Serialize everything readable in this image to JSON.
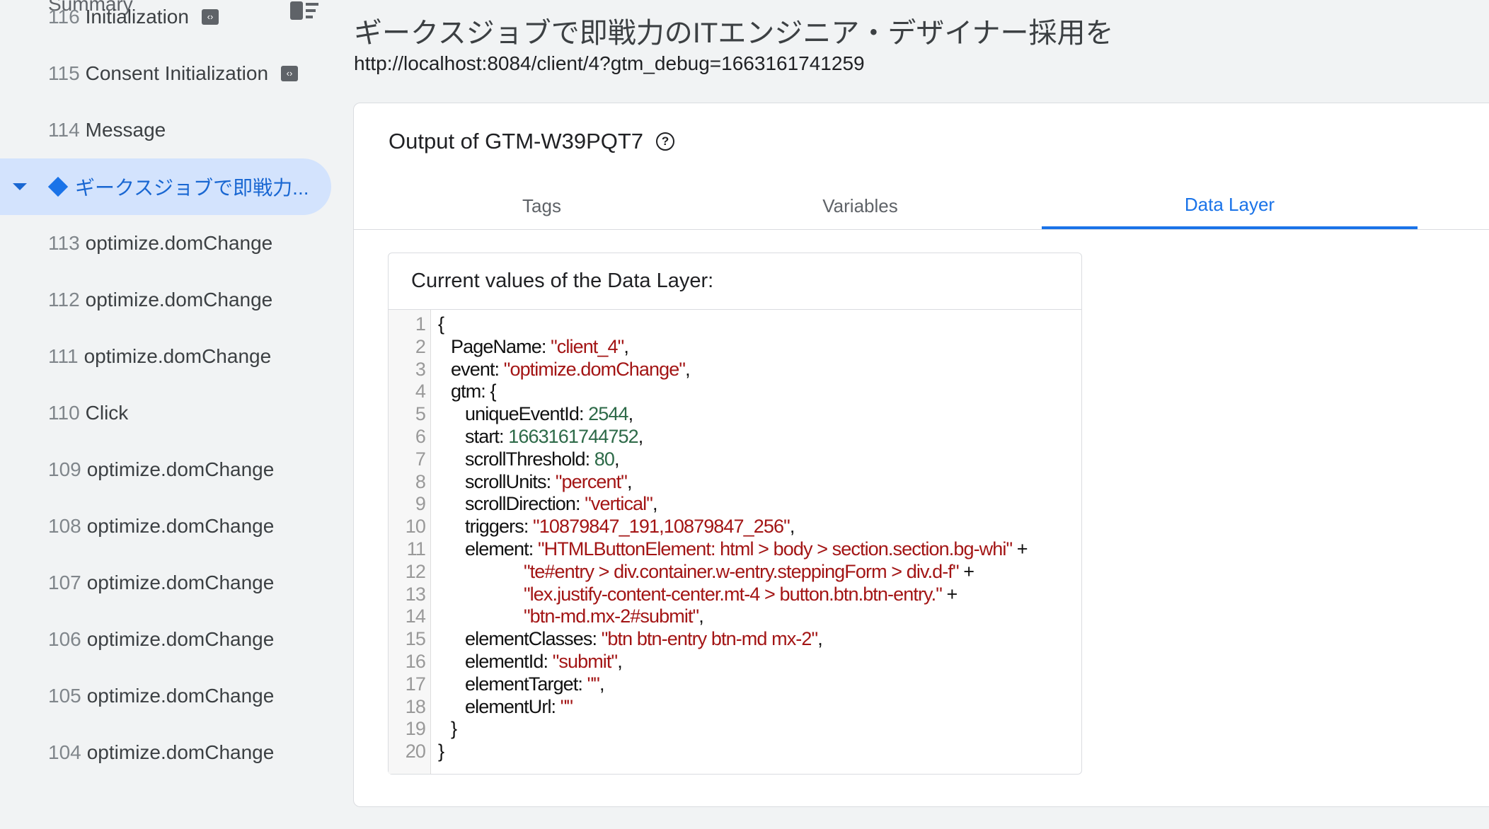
{
  "sidebar": {
    "summary": "Summary",
    "icon": "summary-layout-icon",
    "items": [
      {
        "num": "116",
        "label": "Initialization",
        "badge": true
      },
      {
        "num": "115",
        "label": "Consent Initialization",
        "badge": true
      },
      {
        "num": "114",
        "label": "Message"
      },
      {
        "num": "",
        "label": "ギークスジョブで即戦力...",
        "selected": true
      },
      {
        "num": "113",
        "label": "optimize.domChange"
      },
      {
        "num": "112",
        "label": "optimize.domChange"
      },
      {
        "num": "111",
        "label": "optimize.domChange"
      },
      {
        "num": "110",
        "label": "Click"
      },
      {
        "num": "109",
        "label": "optimize.domChange"
      },
      {
        "num": "108",
        "label": "optimize.domChange"
      },
      {
        "num": "107",
        "label": "optimize.domChange"
      },
      {
        "num": "106",
        "label": "optimize.domChange"
      },
      {
        "num": "105",
        "label": "optimize.domChange"
      },
      {
        "num": "104",
        "label": "optimize.domChange"
      }
    ]
  },
  "header": {
    "title": "ギークスジョブで即戦力のITエンジニア・デザイナー採用を",
    "url": "http://localhost:8084/client/4?gtm_debug=1663161741259"
  },
  "card": {
    "title": "Output of GTM-W39PQT7",
    "tabs": [
      {
        "label": "Tags"
      },
      {
        "label": "Variables"
      },
      {
        "label": "Data Layer",
        "active": true
      }
    ],
    "data_layer": {
      "heading": "Current values of the Data Layer:",
      "lines": [
        [
          {
            "t": "{"
          }
        ],
        [
          {
            "t": "PageName: "
          },
          {
            "t": "\"client_4\"",
            "c": "s"
          },
          {
            "t": ","
          }
        ],
        [
          {
            "t": "event: "
          },
          {
            "t": "\"optimize.domChange\"",
            "c": "s"
          },
          {
            "t": ","
          }
        ],
        [
          {
            "t": "gtm: {"
          }
        ],
        [
          {
            "t": "uniqueEventId: "
          },
          {
            "t": "2544",
            "c": "n"
          },
          {
            "t": ","
          }
        ],
        [
          {
            "t": "start: "
          },
          {
            "t": "1663161744752",
            "c": "n"
          },
          {
            "t": ","
          }
        ],
        [
          {
            "t": "scrollThreshold: "
          },
          {
            "t": "80",
            "c": "n"
          },
          {
            "t": ","
          }
        ],
        [
          {
            "t": "scrollUnits: "
          },
          {
            "t": "\"percent\"",
            "c": "s"
          },
          {
            "t": ","
          }
        ],
        [
          {
            "t": "scrollDirection: "
          },
          {
            "t": "\"vertical\"",
            "c": "s"
          },
          {
            "t": ","
          }
        ],
        [
          {
            "t": "triggers: "
          },
          {
            "t": "\"10879847_191,10879847_256\"",
            "c": "s"
          },
          {
            "t": ","
          }
        ],
        [
          {
            "t": "element: "
          },
          {
            "t": "\"HTMLButtonElement: html > body > section.section.bg-whi\"",
            "c": "s"
          },
          {
            "t": " +"
          }
        ],
        [
          {
            "t": "\"te#entry > div.container.w-entry.steppingForm > div.d-f\"",
            "c": "s"
          },
          {
            "t": " +"
          }
        ],
        [
          {
            "t": "\"lex.justify-content-center.mt-4 > button.btn.btn-entry.\"",
            "c": "s"
          },
          {
            "t": " +"
          }
        ],
        [
          {
            "t": "\"btn-md.mx-2#submit\"",
            "c": "s"
          },
          {
            "t": ","
          }
        ],
        [
          {
            "t": "elementClasses: "
          },
          {
            "t": "\"btn btn-entry btn-md mx-2\"",
            "c": "s"
          },
          {
            "t": ","
          }
        ],
        [
          {
            "t": "elementId: "
          },
          {
            "t": "\"submit\"",
            "c": "s"
          },
          {
            "t": ","
          }
        ],
        [
          {
            "t": "elementTarget: "
          },
          {
            "t": "\"\"",
            "c": "s"
          },
          {
            "t": ","
          }
        ],
        [
          {
            "t": "elementUrl: "
          },
          {
            "t": "\"\"",
            "c": "s"
          }
        ],
        [
          {
            "t": "}"
          }
        ],
        [
          {
            "t": "}"
          }
        ]
      ]
    }
  },
  "colors": {
    "accent": "#1a73e8",
    "string": "#a31515",
    "number": "#2d6a48",
    "selected_bg": "#d3e3fd"
  }
}
